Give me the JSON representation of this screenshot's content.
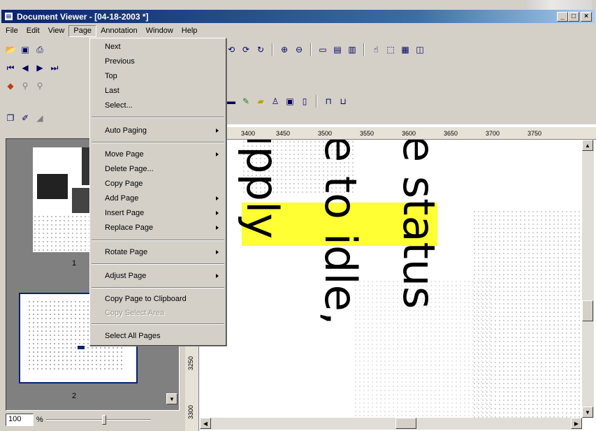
{
  "window": {
    "title": "Document Viewer - [04-18-2003 *]",
    "controls": [
      "_",
      "□",
      "×"
    ]
  },
  "menubar": {
    "items": [
      "File",
      "Edit",
      "View",
      "Page",
      "Annotation",
      "Window",
      "Help"
    ]
  },
  "page_menu": {
    "items": [
      {
        "label": "Next"
      },
      {
        "label": "Previous"
      },
      {
        "label": "Top"
      },
      {
        "label": "Last"
      },
      {
        "label": "Select..."
      },
      {
        "label": "Auto Paging"
      },
      {
        "label": "Move Page"
      },
      {
        "label": "Delete Page..."
      },
      {
        "label": "Copy Page"
      },
      {
        "label": "Add Page"
      },
      {
        "label": "Insert Page"
      },
      {
        "label": "Replace Page"
      },
      {
        "label": "Rotate Page"
      },
      {
        "label": "Adjust Page"
      },
      {
        "label": "Copy Page to Clipboard"
      },
      {
        "label": "Copy Select Area"
      },
      {
        "label": "Select All Pages"
      }
    ]
  },
  "thumbnails": {
    "page1_label": "1",
    "page2_label": "2"
  },
  "zoom": {
    "value": "100",
    "unit": "%"
  },
  "ruler": {
    "horizontal": [
      "3400",
      "3450",
      "3500",
      "3550",
      "3600",
      "3650",
      "3700",
      "3750"
    ],
    "vertical": [
      "3250",
      "3300"
    ]
  },
  "document": {
    "line1": "e status",
    "line2": "e to idle,",
    "line3": "upply"
  }
}
